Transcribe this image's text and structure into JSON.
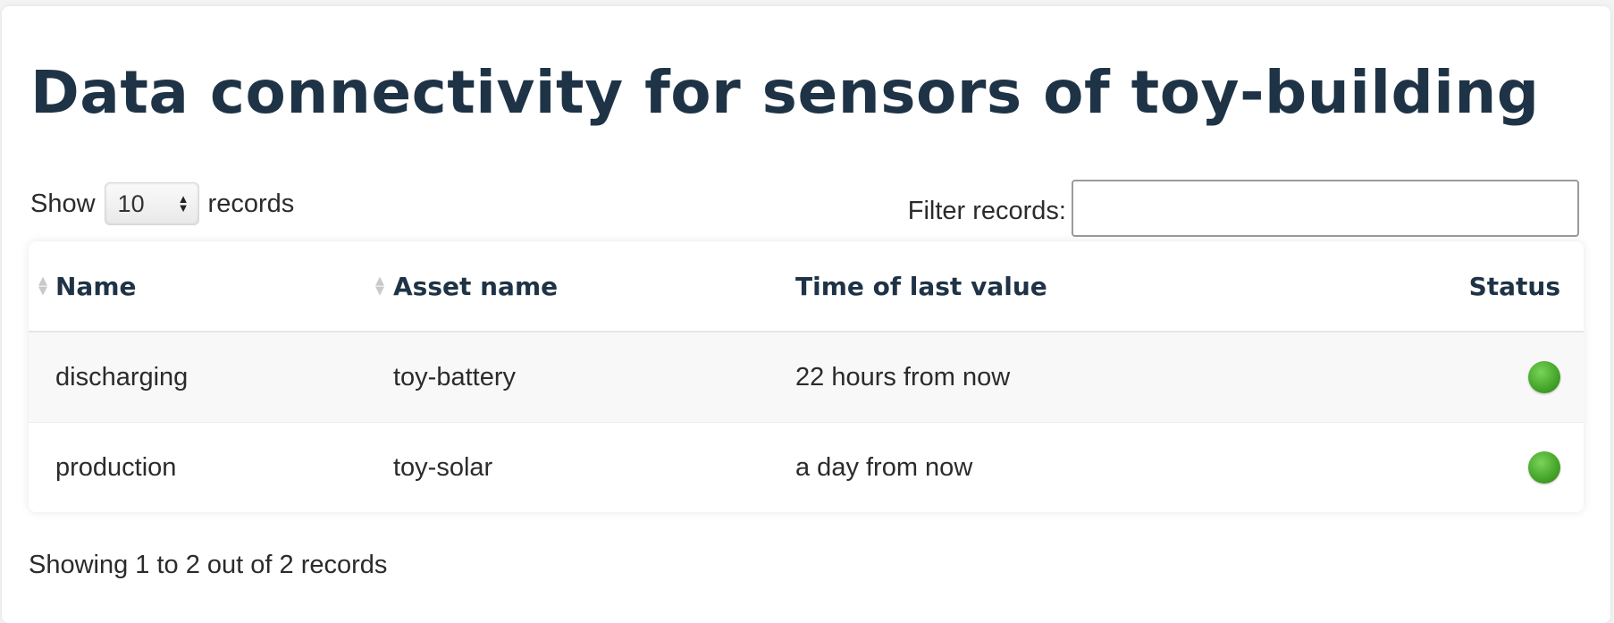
{
  "page": {
    "title": "Data connectivity for sensors of toy-building"
  },
  "length_control": {
    "prefix": "Show",
    "selected": "10",
    "suffix": "records"
  },
  "filter": {
    "label": "Filter records:",
    "value": "",
    "placeholder": ""
  },
  "table": {
    "columns": [
      "Name",
      "Asset name",
      "Time of last value",
      "Status"
    ],
    "rows": [
      {
        "name": "discharging",
        "asset": "toy-battery",
        "time": "22 hours from now",
        "status": "green-status-icon"
      },
      {
        "name": "production",
        "asset": "toy-solar",
        "time": "a day from now",
        "status": "green-status-icon"
      }
    ]
  },
  "footer": {
    "info": "Showing 1 to 2 out of 2 records"
  },
  "colors": {
    "title": "#1f3346",
    "status_ok": "#47a82b"
  }
}
